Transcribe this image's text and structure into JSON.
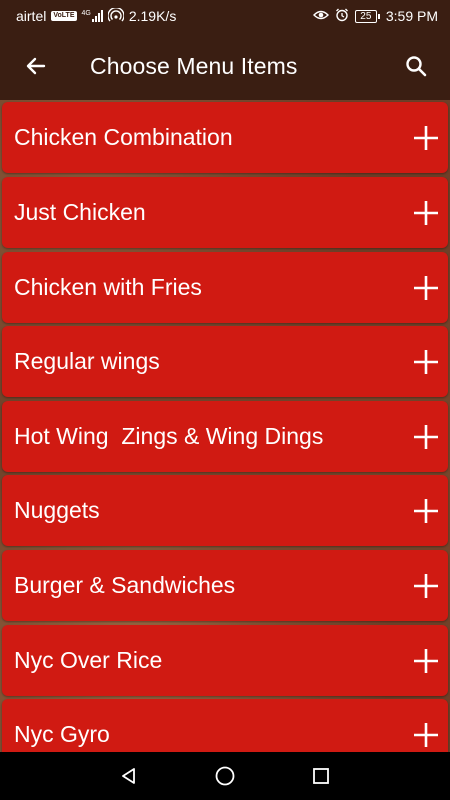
{
  "status_bar": {
    "carrier": "airtel",
    "volte_badge": "VoLTE",
    "network_type": "4G",
    "data_speed": "2.19K/s",
    "battery_level": "25",
    "time": "3:59 PM"
  },
  "app_bar": {
    "title": "Choose Menu Items",
    "back_icon": "arrow-left-icon",
    "search_icon": "search-icon"
  },
  "menu": {
    "items": [
      {
        "label": "Chicken Combination"
      },
      {
        "label": "Just Chicken"
      },
      {
        "label": "Chicken with Fries"
      },
      {
        "label": "Regular wings"
      },
      {
        "label": "Hot Wing  Zings & Wing Dings"
      },
      {
        "label": "Nuggets"
      },
      {
        "label": "Burger & Sandwiches"
      },
      {
        "label": "Nyc Over Rice"
      },
      {
        "label": "Nyc Gyro"
      }
    ],
    "add_icon": "plus-icon"
  },
  "nav_bar": {
    "back_icon": "triangle-back-icon",
    "home_icon": "circle-home-icon",
    "recents_icon": "square-recents-icon"
  },
  "colors": {
    "app_bar": "#3a1e12",
    "item_background": "#d01a12",
    "text": "#ffffff",
    "nav_bar": "#000000"
  }
}
